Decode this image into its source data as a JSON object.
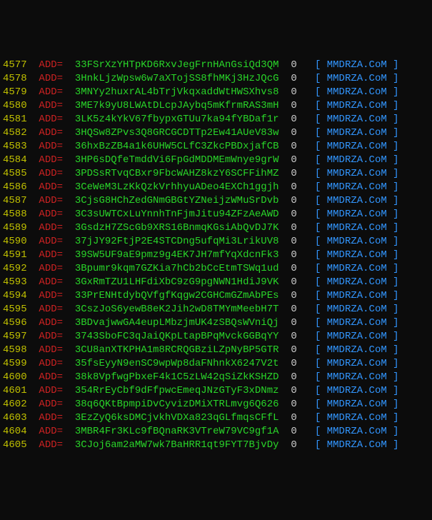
{
  "label": "ADD=",
  "value": "0",
  "tag": "MMDRZA.CoM",
  "bracket_open": "[",
  "bracket_close": "]",
  "rows": [
    {
      "line": "4577",
      "hash": "33FSrXzYHTpKD6RxvJegFrnHAnGsiQd3QM"
    },
    {
      "line": "4578",
      "hash": "3HnkLjzWpsw6w7aXTojSS8fhMKj3HzJQcG"
    },
    {
      "line": "4579",
      "hash": "3MNYy2huxrAL4bTrjVkqxaddWtHWSXhvs8"
    },
    {
      "line": "4580",
      "hash": "3ME7k9yU8LWAtDLcpJAybq5mKfrmRAS3mH"
    },
    {
      "line": "4581",
      "hash": "3LK5z4kYkV67fbypxGTUu7ka94fYBDaf1r"
    },
    {
      "line": "4582",
      "hash": "3HQSw8ZPvs3Q8GRCGCDTTp2Ew41AUeV83w"
    },
    {
      "line": "4583",
      "hash": "36hxBzZB4a1k6UHW5CLfC3ZkcPBDxjafCB"
    },
    {
      "line": "4584",
      "hash": "3HP6sDQfeTmddVi6FpGdMDDMEmWnye9grW"
    },
    {
      "line": "4585",
      "hash": "3PDSsRTvqCBxr9FbcWAHZ8kzY6SCFFihMZ"
    },
    {
      "line": "4586",
      "hash": "3CeWeM3LzKkQzkVrhhyuADeo4EXCh1ggjh"
    },
    {
      "line": "4587",
      "hash": "3CjsG8HChZedGNmGBGtYZNeijzWMuSrDvb"
    },
    {
      "line": "4588",
      "hash": "3C3sUWTCxLuYnnhTnFjmJitu94ZFzAeAWD"
    },
    {
      "line": "4589",
      "hash": "3GsdzH7ZScGb9XRS16BnmqKGsiAbQvDJ7K"
    },
    {
      "line": "4590",
      "hash": "37jJY92FtjP2E4STCDng5ufqMi3LrikUV8"
    },
    {
      "line": "4591",
      "hash": "39SW5UF9aE9pmz9g4EK7JH7mfYqXdcnFk3"
    },
    {
      "line": "4592",
      "hash": "3Bpumr9kqm7GZKia7hCb2bCcEtmTSWq1ud"
    },
    {
      "line": "4593",
      "hash": "3GxRmTZU1LHFdiXbC9zG9pgNWN1HdiJ9VK"
    },
    {
      "line": "4594",
      "hash": "33PrENHtdybQVfgfKqgw2CGHCmGZmAbPEs"
    },
    {
      "line": "4595",
      "hash": "3CszJoS6yewB8eK2Jih2wD8TMYmMeebH7T"
    },
    {
      "line": "4596",
      "hash": "3BDvajwwGA4eupLMbzjmUK4zSBQsWVniQj"
    },
    {
      "line": "4597",
      "hash": "3743SboFC3qJaiQKpLtapBPqMvckGGBqYY"
    },
    {
      "line": "4598",
      "hash": "3CU8anXTKPHA1m8RCRQGBziLZpNyBP5GTR"
    },
    {
      "line": "4599",
      "hash": "35fsEyyN9enSC9wpWp8daFNhnkX6247V2t"
    },
    {
      "line": "4600",
      "hash": "38k8VpfwgPbxeF4k1C5zLW42qSiZkKSHZD"
    },
    {
      "line": "4601",
      "hash": "354RrEyCbf9dFfpwcEmeqJNzGTyF3xDNmz"
    },
    {
      "line": "4602",
      "hash": "38q6QKtBpmpiDvCyvizDMiXTRLmvg6Q626"
    },
    {
      "line": "4603",
      "hash": "3EzZyQ6ksDMCjvkhVDXa823qGLfmqsCFfL"
    },
    {
      "line": "4604",
      "hash": "3MBR4Fr3KLc9fBQnaRK3VTreW79VC9gf1A"
    },
    {
      "line": "4605",
      "hash": "3CJoj6am2aMW7wk7BaHRR1qt9FYT7BjvDy"
    }
  ]
}
